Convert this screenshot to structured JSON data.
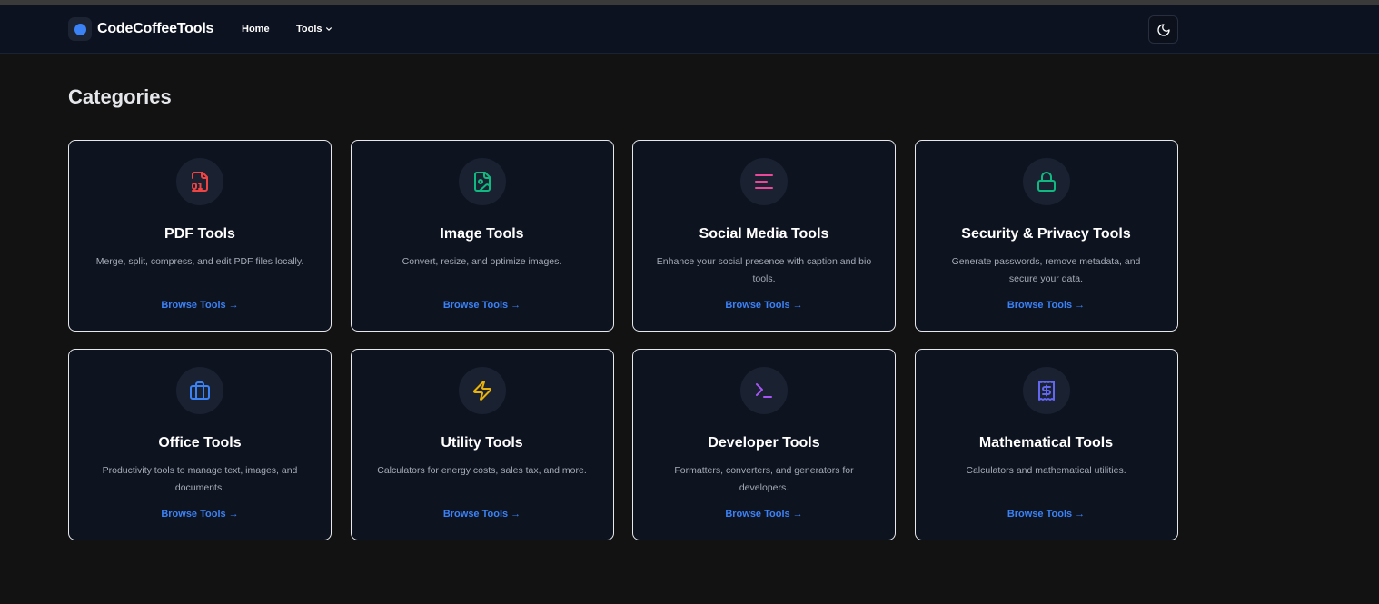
{
  "header": {
    "brand": "CodeCoffeeTools",
    "nav": {
      "home": "Home",
      "tools": "Tools"
    }
  },
  "main": {
    "title": "Categories",
    "categories": [
      {
        "title": "PDF Tools",
        "description": "Merge, split, compress, and edit PDF files locally.",
        "link": "Browse Tools →",
        "icon": "pdf-file-icon",
        "color": "#ef4444"
      },
      {
        "title": "Image Tools",
        "description": "Convert, resize, and optimize images.",
        "link": "Browse Tools →",
        "icon": "image-file-icon",
        "color": "#10b981"
      },
      {
        "title": "Social Media Tools",
        "description": "Enhance your social presence with caption and bio tools.",
        "link": "Browse Tools →",
        "icon": "text-lines-icon",
        "color": "#ec4899"
      },
      {
        "title": "Security & Privacy Tools",
        "description": "Generate passwords, remove metadata, and secure your data.",
        "link": "Browse Tools →",
        "icon": "lock-icon",
        "color": "#10b981"
      },
      {
        "title": "Office Tools",
        "description": "Productivity tools to manage text, images, and documents.",
        "link": "Browse Tools →",
        "icon": "briefcase-icon",
        "color": "#3b82f6"
      },
      {
        "title": "Utility Tools",
        "description": "Calculators for energy costs, sales tax, and more.",
        "link": "Browse Tools →",
        "icon": "lightning-icon",
        "color": "#eab308"
      },
      {
        "title": "Developer Tools",
        "description": "Formatters, converters, and generators for developers.",
        "link": "Browse Tools →",
        "icon": "terminal-icon",
        "color": "#a855f7"
      },
      {
        "title": "Mathematical Tools",
        "description": "Calculators and mathematical utilities.",
        "link": "Browse Tools →",
        "icon": "receipt-dollar-icon",
        "color": "#6366f1"
      }
    ]
  }
}
